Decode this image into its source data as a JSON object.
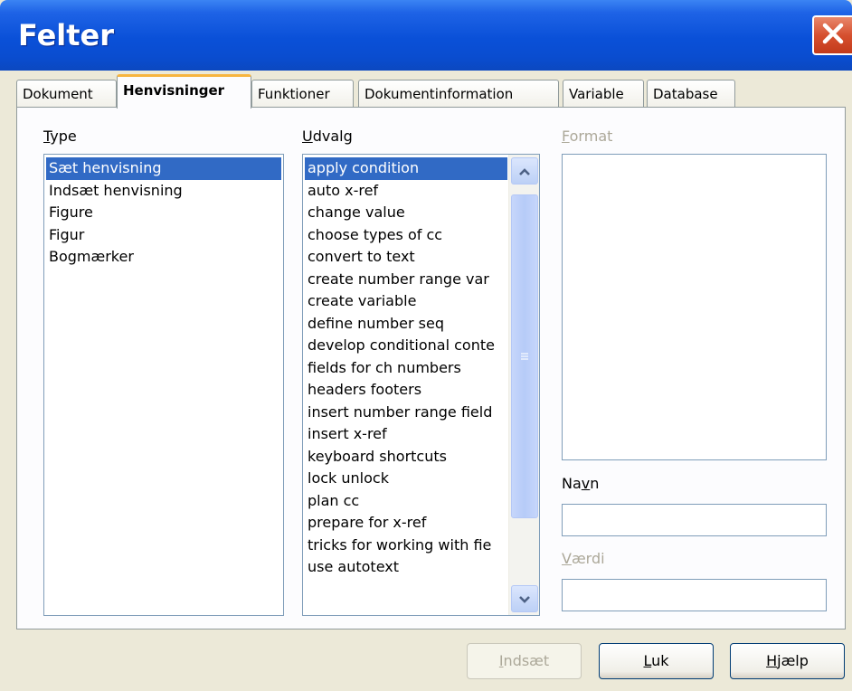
{
  "window": {
    "title": "Felter"
  },
  "tabs": [
    {
      "label": "Dokument"
    },
    {
      "label": "Henvisninger"
    },
    {
      "label": "Funktioner"
    },
    {
      "label": "Dokumentinformation"
    },
    {
      "label": "Variable"
    },
    {
      "label": "Database"
    }
  ],
  "type": {
    "label_u": "T",
    "label_rest": "ype",
    "items": [
      "Sæt henvisning",
      "Indsæt henvisning",
      "Figure",
      "Figur",
      "Bogmærker"
    ],
    "selected_index": 0
  },
  "udvalg": {
    "label_u": "U",
    "label_rest": "dvalg",
    "items": [
      "apply condition",
      "auto x-ref",
      "change value",
      "choose types of cc",
      "convert to text",
      "create number range var",
      "create variable",
      "define number seq",
      "develop conditional conte",
      "fields for ch numbers",
      "headers footers",
      "insert number range field",
      "insert x-ref",
      "keyboard shortcuts",
      "lock unlock",
      "plan cc",
      "prepare for x-ref",
      "tricks for working with fie",
      "use autotext"
    ],
    "selected_index": 0
  },
  "format": {
    "label_u": "F",
    "label_rest": "ormat"
  },
  "navn": {
    "label_pre": "Na",
    "label_u": "v",
    "label_rest": "n",
    "value": ""
  },
  "vaerdi": {
    "label_u": "V",
    "label_rest": "ærdi",
    "value": ""
  },
  "buttons": {
    "insert": {
      "label_u": "I",
      "label_rest": "ndsæt"
    },
    "close": {
      "label_u": "L",
      "label_rest": "uk"
    },
    "help": {
      "label_u": "H",
      "label_rest": "jælp"
    }
  },
  "colors": {
    "titlebar": "#0a50d8",
    "selection": "#316ac5",
    "close_button": "#d6502f",
    "active_tab_highlight": "#f7b540"
  }
}
